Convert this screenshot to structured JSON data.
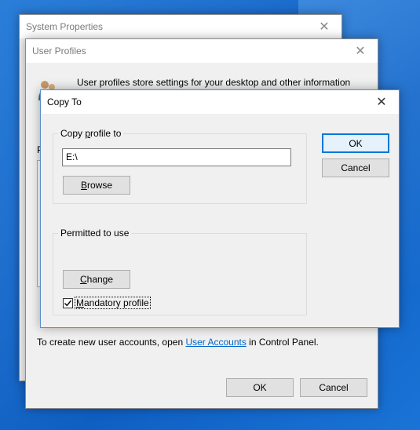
{
  "system_properties": {
    "title": "System Properties"
  },
  "user_profiles": {
    "title": "User Profiles",
    "description": "User profiles store settings for your desktop and other information",
    "letter_partial": "P",
    "footer_text_before": "To create new user accounts, open ",
    "footer_link": "User Accounts",
    "footer_text_after": " in Control Panel.",
    "ok_label": "OK",
    "cancel_label": "Cancel"
  },
  "copy_to": {
    "title": "Copy To",
    "copy_profile_to": {
      "legend_prefix": "Copy ",
      "legend_accel": "p",
      "legend_suffix": "rofile to",
      "path_value": "E:\\",
      "browse_accel": "B",
      "browse_rest": "rowse"
    },
    "permitted": {
      "legend": "Permitted to use",
      "change_accel": "C",
      "change_rest": "hange",
      "mandatory_accel": "M",
      "mandatory_rest": "andatory profile",
      "mandatory_checked": true
    },
    "ok_label": "OK",
    "cancel_label": "Cancel"
  },
  "icons": {
    "close": "close-icon",
    "users": "users-icon",
    "check": "checkmark-icon"
  }
}
